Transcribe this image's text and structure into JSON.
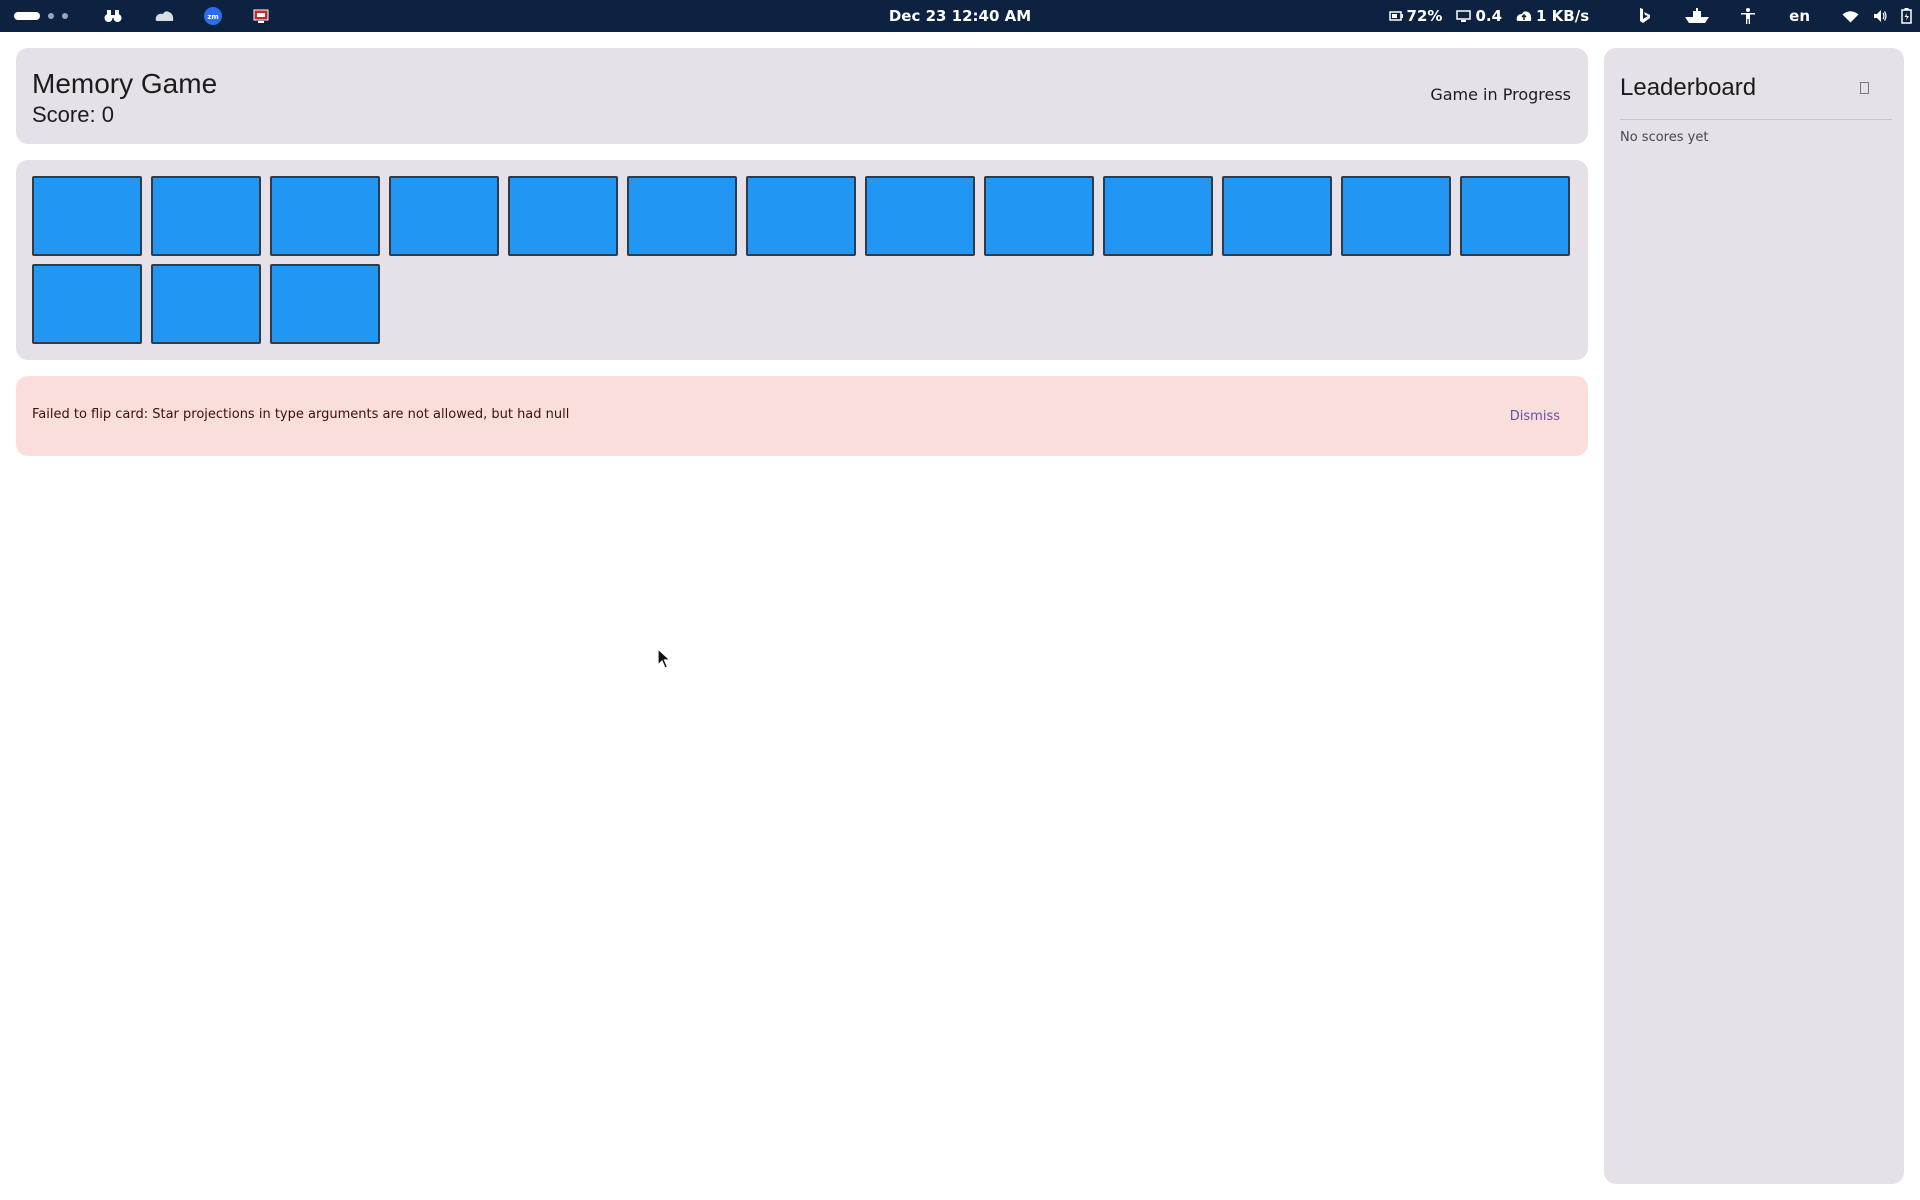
{
  "topbar": {
    "datetime": "Dec 23  12:40 AM",
    "battery": "72%",
    "cpu": "0.4",
    "network": "1 KB/s",
    "language": "en"
  },
  "game": {
    "title": "Memory Game",
    "score_label": "Score: 0",
    "status": "Game in Progress",
    "card_count": 16,
    "card_color": "#2196f3"
  },
  "error": {
    "message": "Failed to flip card: Star projections in type arguments are not allowed, but had null",
    "dismiss_label": "Dismiss"
  },
  "leaderboard": {
    "title": "Leaderboard",
    "empty_text": "No scores yet",
    "refresh_icon": "refresh-icon"
  },
  "colors": {
    "topbar": "#0d2240",
    "surface": "#e6e1e9",
    "error_container": "#f9dedc",
    "primary": "#6750a4"
  }
}
